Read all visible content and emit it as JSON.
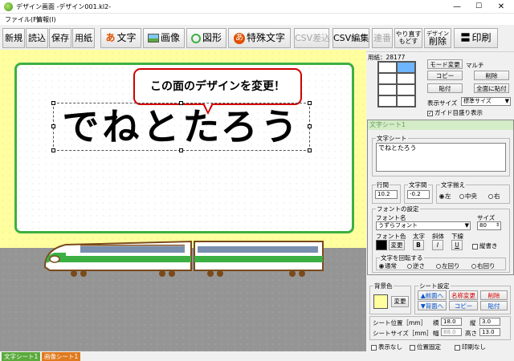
{
  "window": {
    "title": "デザイン画面 -デザイン001.kl2-",
    "min": "—",
    "max": "☐",
    "close": "✕"
  },
  "menu": {
    "file": "ファイル(F)",
    "info": "情報(I)"
  },
  "toolbar": {
    "new": "新規",
    "load": "読込",
    "save": "保存",
    "paper": "用紙",
    "text_icon": "あ",
    "text": "文字",
    "image": "画像",
    "shape": "図形",
    "special_icon": "あ",
    "special": "特殊文字",
    "csv_import": "CSV差込",
    "csv_edit": "CSV編集",
    "serial": "連番",
    "redo": "やり直す",
    "undo": "もどす",
    "delete_top": "デザイン",
    "delete": "削除",
    "print": "印刷"
  },
  "canvas": {
    "callout": "この面のデザインを変更！",
    "sheet_text": "でねとたろう"
  },
  "right_panel": {
    "paper_info": "用紙：28177",
    "mode_label": "モード変更",
    "mode_value": "マルチ",
    "copy": "コピー",
    "delete": "削除",
    "paste": "貼付",
    "paste_all": "全面に貼付",
    "display_size_label": "表示サイズ",
    "display_size_value": "標準サイズ",
    "guide_label": "ガイド目盛り表示",
    "guide_checked": "✓"
  },
  "sheet_panel": {
    "tab": "文字シート1",
    "text_group": "文字シート",
    "text_value": "でねとたろう",
    "line_spacing_label": "行間",
    "line_spacing": "10.2",
    "char_spacing_label": "文字間",
    "char_spacing": "-0.2",
    "align_label": "文字揃え",
    "align_left": "左",
    "align_center": "中央",
    "align_right": "右",
    "font_group": "フォントの設定",
    "font_name_label": "フォント名",
    "font_name": "うずらフォント",
    "size_label": "サイズ",
    "size": "80",
    "color_label": "フォント色",
    "bold_label": "太字",
    "italic_label": "斜体",
    "underline_label": "下線",
    "change": "変更",
    "bold": "B",
    "italic": "I",
    "underline": "U",
    "vertical": "縦書き",
    "rotate_group": "文字を回転する",
    "rot_normal": "通常",
    "rot_reverse": "逆さ",
    "rot_left": "左回り",
    "rot_right": "右回り"
  },
  "bottom_panel": {
    "bg_label": "背景色",
    "bg_change": "変更",
    "sheet_setting": "シート設定",
    "to_front": "▲前面へ",
    "to_back": "▼背面へ",
    "name_change": "名称変更",
    "copy": "コピー",
    "delete": "削除",
    "paste": "貼付",
    "pos_label": "シート位置［mm］",
    "x_label": "横",
    "x": "18.0",
    "y_label": "縦",
    "y": "3.0",
    "size_label": "シートサイズ［mm］",
    "w_label": "幅",
    "w": "88.0",
    "h_label": "高さ",
    "h": "13.0",
    "hide": "表示なし",
    "fix_pos": "位置固定",
    "no_print": "印刷なし"
  },
  "status": {
    "tab1": "文字シート1",
    "tab2": "画像シート1"
  },
  "colors": {
    "accent_green": "#3cb043",
    "callout_red": "#d00000",
    "yellow_bg": "#ffffa0",
    "tab1": "#5aaa3c",
    "tab2": "#e07a1e"
  }
}
